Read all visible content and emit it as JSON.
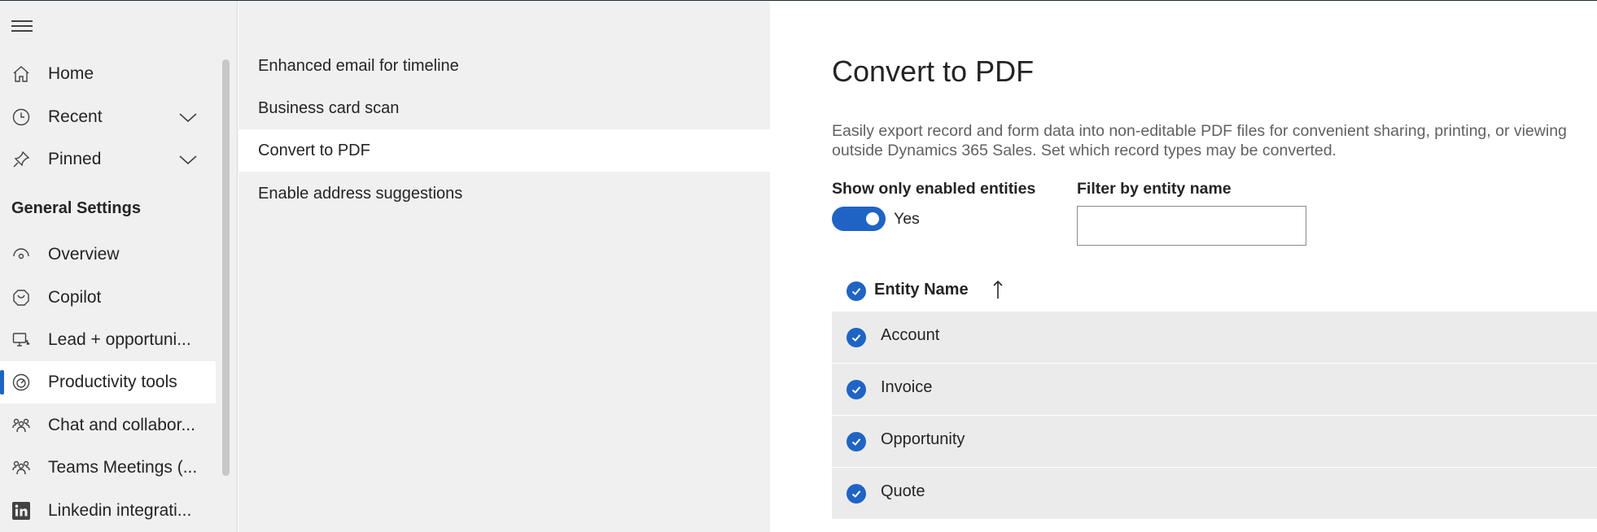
{
  "nav": {
    "items": [
      {
        "label": "Home",
        "icon": "home-icon"
      },
      {
        "label": "Recent",
        "icon": "clock-icon"
      },
      {
        "label": "Pinned",
        "icon": "pin-icon"
      }
    ],
    "section_heading": "General Settings",
    "settings_items": [
      {
        "label": "Overview",
        "icon": "overview-icon"
      },
      {
        "label": "Copilot",
        "icon": "copilot-icon"
      },
      {
        "label": "Lead + opportuni...",
        "icon": "lead-opportunity-icon"
      },
      {
        "label": "Productivity tools",
        "icon": "gauge-icon",
        "selected": true
      },
      {
        "label": "Chat and collabor...",
        "icon": "people-icon"
      },
      {
        "label": "Teams Meetings (...",
        "icon": "people-icon"
      },
      {
        "label": "Linkedin integrati...",
        "icon": "linkedin-icon"
      }
    ]
  },
  "middle": {
    "items": [
      {
        "label": "Enhanced email for timeline"
      },
      {
        "label": "Business card scan"
      },
      {
        "label": "Convert to PDF",
        "active": true
      },
      {
        "label": "Enable address suggestions"
      }
    ]
  },
  "content": {
    "title": "Convert to PDF",
    "description": "Easily export record and form data into non-editable PDF files for convenient sharing, printing, or viewing outside Dynamics 365 Sales. Set which record types may be converted.",
    "toggle_label": "Show only enabled entities",
    "toggle_value": "Yes",
    "toggle_on": true,
    "filter_label": "Filter by entity name",
    "filter_value": "",
    "grid": {
      "column": "Entity Name",
      "sort_icon": "arrow-up-icon",
      "rows": [
        {
          "name": "Account"
        },
        {
          "name": "Invoice"
        },
        {
          "name": "Opportunity"
        },
        {
          "name": "Quote"
        }
      ]
    }
  },
  "colors": {
    "accent": "#1f64c4",
    "nav_bg": "#f0f0f0",
    "row_bg": "#ebebeb"
  }
}
